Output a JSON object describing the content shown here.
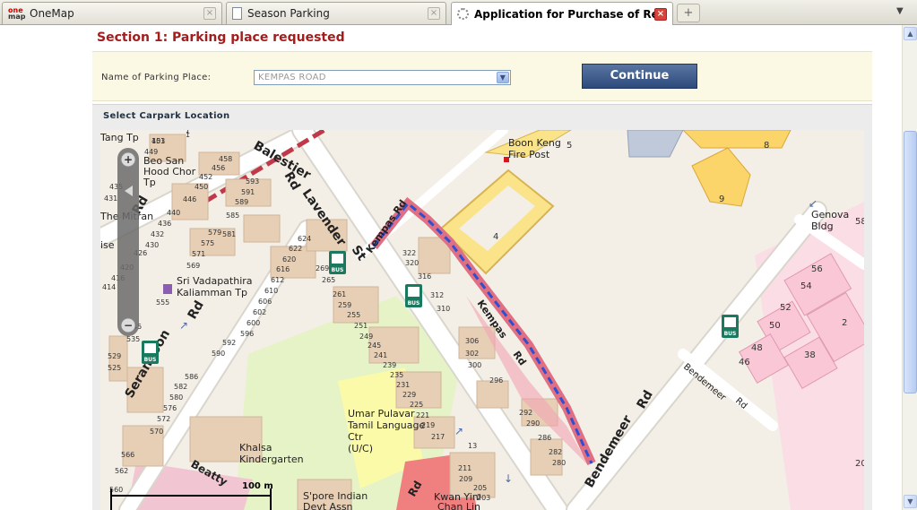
{
  "tabs": [
    {
      "title": "OneMap",
      "icon": "onemap-logo-icon",
      "close": "×"
    },
    {
      "title": "Season Parking",
      "icon": "page-icon",
      "close": "×"
    },
    {
      "title": "Application for Purchase of Resid...",
      "icon": "loading-spinner-icon",
      "close": "×"
    }
  ],
  "tab_new": "+",
  "tab_menu": "▼",
  "page": {
    "section_title": "Section 1: Parking place requested",
    "parking_label": "Name of Parking Place:",
    "parking_value": "KEMPAS ROAD",
    "continue_label": "Continue",
    "carpark_label": "Select Carpark Location"
  },
  "map": {
    "zoom_in": "+",
    "zoom_out": "−",
    "scale_label": "100 m",
    "roads": [
      "Balestier",
      "Rd",
      "Lavender",
      "St",
      "Kempas Rd",
      "Kempas Rd",
      "Serangoon",
      "Rd",
      "Rd",
      "Bendemeer",
      "Rd",
      "Bendemeer",
      "Rd",
      "Beatty",
      "Rd",
      "Kempas",
      "Rd"
    ],
    "places": [
      "Tang Tp",
      "Beo San Hood Chor Tp",
      "The Mitran",
      "Sri Vadapathira Kaliamman Tp",
      "Boon Keng Fire Post",
      "Genova Bldg",
      "Umar Pulavar Tamil Language Ctr (U/C)",
      "Khalsa Kindergarten",
      "S'pore Indian Devt Assn",
      "Kwan Yin Chan Lin",
      "ise",
      "Rd"
    ],
    "bus_label": "BUS",
    "block_numbers": [
      "451",
      "449",
      "1",
      "458",
      "456",
      "452",
      "450",
      "593",
      "591",
      "589",
      "435",
      "431",
      "446",
      "440",
      "436",
      "432",
      "430",
      "426",
      "420",
      "416",
      "414",
      "585",
      "579",
      "581",
      "575",
      "571",
      "569",
      "555",
      "624",
      "622",
      "620",
      "616",
      "612",
      "610",
      "606",
      "602",
      "600",
      "596",
      "592",
      "590",
      "269",
      "265",
      "261",
      "259",
      "255",
      "251",
      "249",
      "245",
      "241",
      "239",
      "235",
      "231",
      "229",
      "225",
      "221",
      "219",
      "217",
      "322",
      "320",
      "316",
      "312",
      "310",
      "306",
      "302",
      "300",
      "296",
      "292",
      "290",
      "286",
      "282",
      "280",
      "211",
      "209",
      "205",
      "203",
      "586",
      "582",
      "580",
      "576",
      "572",
      "570",
      "566",
      "562",
      "560",
      "529",
      "525",
      "45",
      "535",
      "4",
      "5",
      "8",
      "9",
      "56",
      "54",
      "52",
      "50",
      "2",
      "48",
      "46",
      "38",
      "58",
      "20",
      "1",
      "13",
      "3",
      "103"
    ]
  }
}
